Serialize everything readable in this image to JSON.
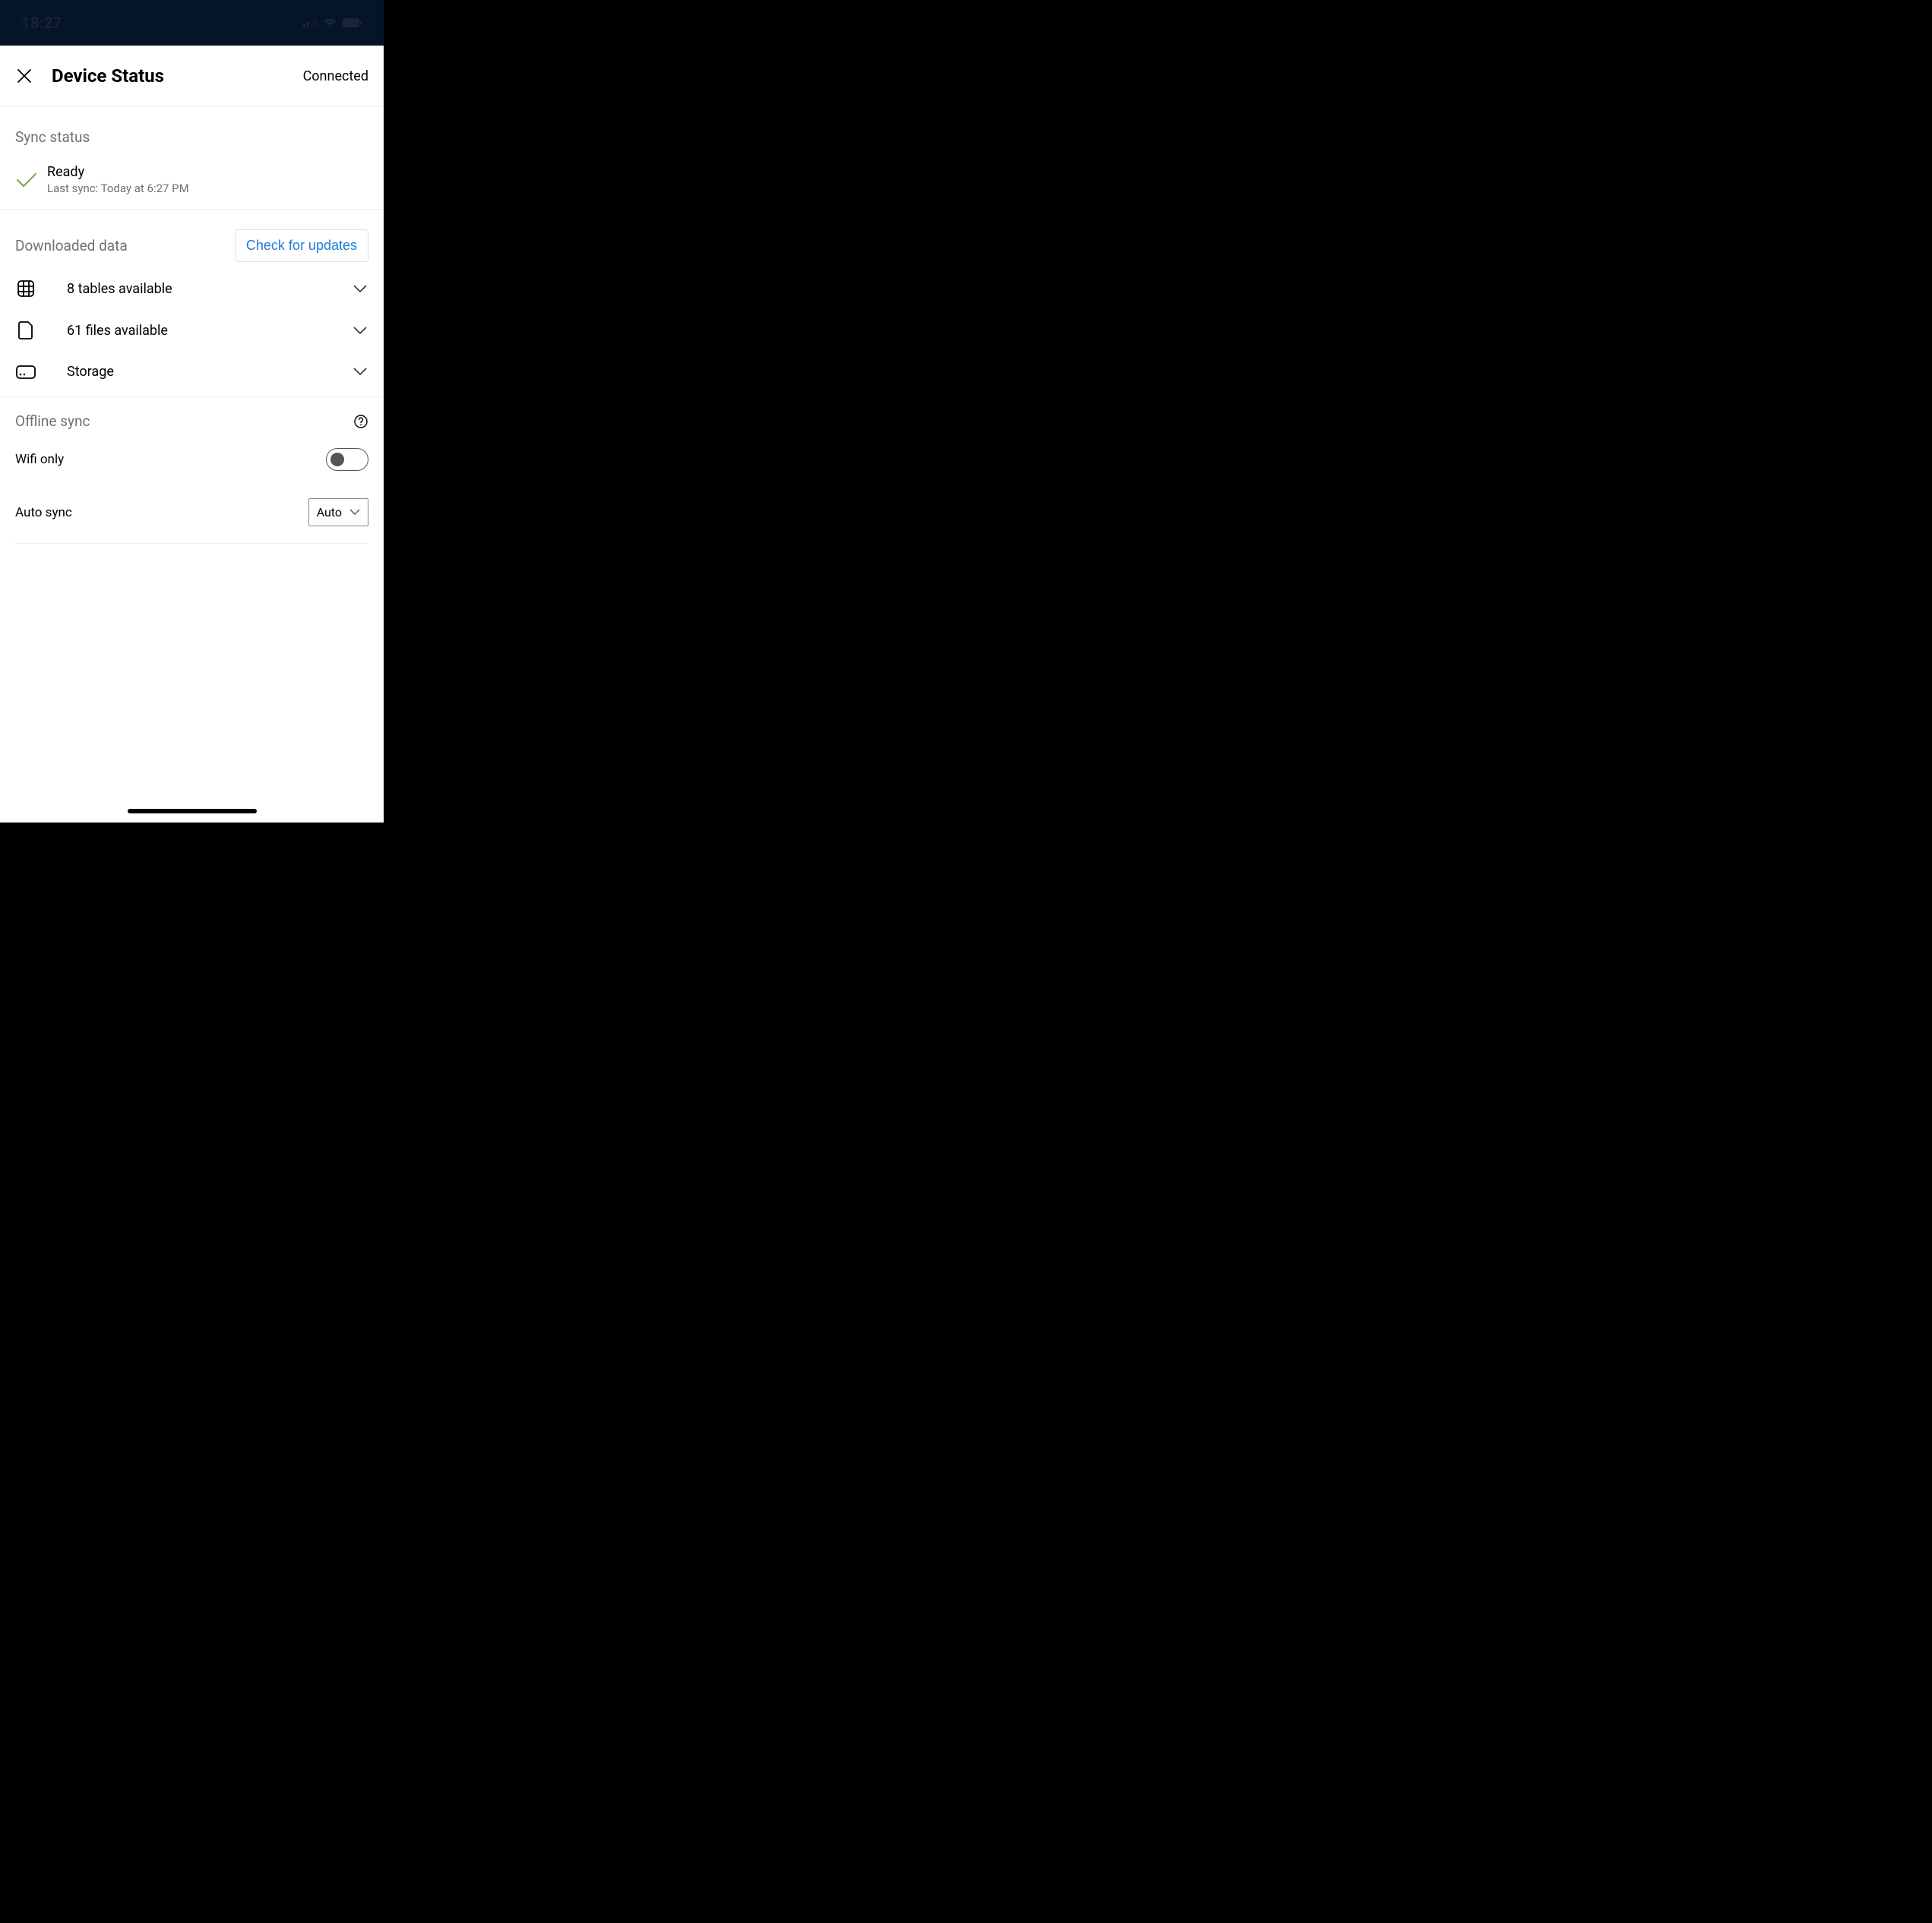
{
  "statusBar": {
    "time": "18:27"
  },
  "header": {
    "title": "Device Status",
    "connection": "Connected"
  },
  "syncStatus": {
    "section_label": "Sync status",
    "main": "Ready",
    "sub": "Last sync: Today at 6:27 PM"
  },
  "downloaded": {
    "section_label": "Downloaded data",
    "check_updates_label": "Check for updates",
    "tables": "8 tables available",
    "files": "61 files available",
    "storage": "Storage"
  },
  "offline": {
    "section_label": "Offline sync",
    "wifi_only_label": "Wifi only",
    "auto_sync_label": "Auto sync",
    "auto_sync_value": "Auto"
  }
}
